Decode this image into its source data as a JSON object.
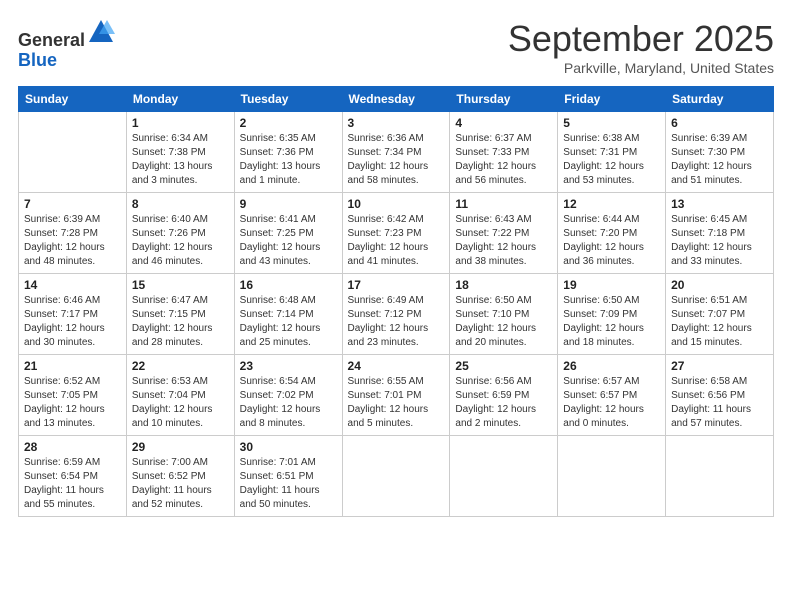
{
  "logo": {
    "general": "General",
    "blue": "Blue"
  },
  "header": {
    "month": "September 2025",
    "location": "Parkville, Maryland, United States"
  },
  "weekdays": [
    "Sunday",
    "Monday",
    "Tuesday",
    "Wednesday",
    "Thursday",
    "Friday",
    "Saturday"
  ],
  "weeks": [
    [
      {
        "day": "",
        "info": ""
      },
      {
        "day": "1",
        "info": "Sunrise: 6:34 AM\nSunset: 7:38 PM\nDaylight: 13 hours\nand 3 minutes."
      },
      {
        "day": "2",
        "info": "Sunrise: 6:35 AM\nSunset: 7:36 PM\nDaylight: 13 hours\nand 1 minute."
      },
      {
        "day": "3",
        "info": "Sunrise: 6:36 AM\nSunset: 7:34 PM\nDaylight: 12 hours\nand 58 minutes."
      },
      {
        "day": "4",
        "info": "Sunrise: 6:37 AM\nSunset: 7:33 PM\nDaylight: 12 hours\nand 56 minutes."
      },
      {
        "day": "5",
        "info": "Sunrise: 6:38 AM\nSunset: 7:31 PM\nDaylight: 12 hours\nand 53 minutes."
      },
      {
        "day": "6",
        "info": "Sunrise: 6:39 AM\nSunset: 7:30 PM\nDaylight: 12 hours\nand 51 minutes."
      }
    ],
    [
      {
        "day": "7",
        "info": "Sunrise: 6:39 AM\nSunset: 7:28 PM\nDaylight: 12 hours\nand 48 minutes."
      },
      {
        "day": "8",
        "info": "Sunrise: 6:40 AM\nSunset: 7:26 PM\nDaylight: 12 hours\nand 46 minutes."
      },
      {
        "day": "9",
        "info": "Sunrise: 6:41 AM\nSunset: 7:25 PM\nDaylight: 12 hours\nand 43 minutes."
      },
      {
        "day": "10",
        "info": "Sunrise: 6:42 AM\nSunset: 7:23 PM\nDaylight: 12 hours\nand 41 minutes."
      },
      {
        "day": "11",
        "info": "Sunrise: 6:43 AM\nSunset: 7:22 PM\nDaylight: 12 hours\nand 38 minutes."
      },
      {
        "day": "12",
        "info": "Sunrise: 6:44 AM\nSunset: 7:20 PM\nDaylight: 12 hours\nand 36 minutes."
      },
      {
        "day": "13",
        "info": "Sunrise: 6:45 AM\nSunset: 7:18 PM\nDaylight: 12 hours\nand 33 minutes."
      }
    ],
    [
      {
        "day": "14",
        "info": "Sunrise: 6:46 AM\nSunset: 7:17 PM\nDaylight: 12 hours\nand 30 minutes."
      },
      {
        "day": "15",
        "info": "Sunrise: 6:47 AM\nSunset: 7:15 PM\nDaylight: 12 hours\nand 28 minutes."
      },
      {
        "day": "16",
        "info": "Sunrise: 6:48 AM\nSunset: 7:14 PM\nDaylight: 12 hours\nand 25 minutes."
      },
      {
        "day": "17",
        "info": "Sunrise: 6:49 AM\nSunset: 7:12 PM\nDaylight: 12 hours\nand 23 minutes."
      },
      {
        "day": "18",
        "info": "Sunrise: 6:50 AM\nSunset: 7:10 PM\nDaylight: 12 hours\nand 20 minutes."
      },
      {
        "day": "19",
        "info": "Sunrise: 6:50 AM\nSunset: 7:09 PM\nDaylight: 12 hours\nand 18 minutes."
      },
      {
        "day": "20",
        "info": "Sunrise: 6:51 AM\nSunset: 7:07 PM\nDaylight: 12 hours\nand 15 minutes."
      }
    ],
    [
      {
        "day": "21",
        "info": "Sunrise: 6:52 AM\nSunset: 7:05 PM\nDaylight: 12 hours\nand 13 minutes."
      },
      {
        "day": "22",
        "info": "Sunrise: 6:53 AM\nSunset: 7:04 PM\nDaylight: 12 hours\nand 10 minutes."
      },
      {
        "day": "23",
        "info": "Sunrise: 6:54 AM\nSunset: 7:02 PM\nDaylight: 12 hours\nand 8 minutes."
      },
      {
        "day": "24",
        "info": "Sunrise: 6:55 AM\nSunset: 7:01 PM\nDaylight: 12 hours\nand 5 minutes."
      },
      {
        "day": "25",
        "info": "Sunrise: 6:56 AM\nSunset: 6:59 PM\nDaylight: 12 hours\nand 2 minutes."
      },
      {
        "day": "26",
        "info": "Sunrise: 6:57 AM\nSunset: 6:57 PM\nDaylight: 12 hours\nand 0 minutes."
      },
      {
        "day": "27",
        "info": "Sunrise: 6:58 AM\nSunset: 6:56 PM\nDaylight: 11 hours\nand 57 minutes."
      }
    ],
    [
      {
        "day": "28",
        "info": "Sunrise: 6:59 AM\nSunset: 6:54 PM\nDaylight: 11 hours\nand 55 minutes."
      },
      {
        "day": "29",
        "info": "Sunrise: 7:00 AM\nSunset: 6:52 PM\nDaylight: 11 hours\nand 52 minutes."
      },
      {
        "day": "30",
        "info": "Sunrise: 7:01 AM\nSunset: 6:51 PM\nDaylight: 11 hours\nand 50 minutes."
      },
      {
        "day": "",
        "info": ""
      },
      {
        "day": "",
        "info": ""
      },
      {
        "day": "",
        "info": ""
      },
      {
        "day": "",
        "info": ""
      }
    ]
  ]
}
